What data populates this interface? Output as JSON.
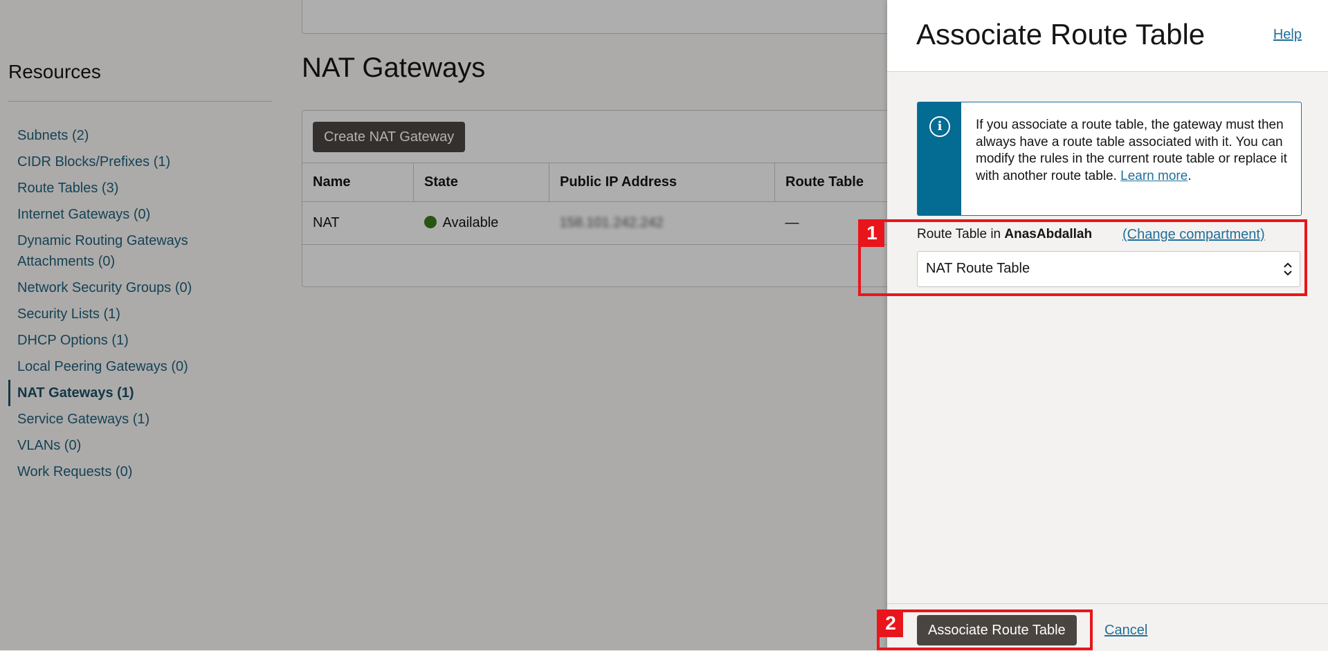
{
  "sidebar": {
    "title": "Resources",
    "items": [
      {
        "label": "Subnets (2)"
      },
      {
        "label": "CIDR Blocks/Prefixes (1)"
      },
      {
        "label": "Route Tables (3)"
      },
      {
        "label": "Internet Gateways (0)"
      },
      {
        "label": "Dynamic Routing Gateways Attachments (0)"
      },
      {
        "label": "Network Security Groups (0)"
      },
      {
        "label": "Security Lists (1)"
      },
      {
        "label": "DHCP Options (1)"
      },
      {
        "label": "Local Peering Gateways (0)"
      },
      {
        "label": "NAT Gateways (1)",
        "active": true
      },
      {
        "label": "Service Gateways (1)"
      },
      {
        "label": "VLANs (0)"
      },
      {
        "label": "Work Requests (0)"
      }
    ]
  },
  "main": {
    "title": "NAT Gateways",
    "create_button": "Create NAT Gateway",
    "columns": [
      "Name",
      "State",
      "Public IP Address",
      "Route Table"
    ],
    "rows": [
      {
        "name": "NAT",
        "state": "Available",
        "public_ip": "158.101.242.242",
        "route_table": "—"
      }
    ]
  },
  "panel": {
    "title": "Associate Route Table",
    "help": "Help",
    "info_text": "If you associate a route table, the gateway must then always have a route table associated with it. You can modify the rules in the current route table or replace it with another route table.",
    "info_link": "Learn more",
    "info_after": ".",
    "field_label_prefix": "Route Table in",
    "compartment": "AnasAbdallah",
    "change_compartment": "(Change compartment)",
    "selected_route_table": "NAT Route Table",
    "submit": "Associate Route Table",
    "cancel": "Cancel"
  },
  "annotations": {
    "step1": "1",
    "step2": "2"
  },
  "colors": {
    "accent_link": "#1f6f9a",
    "info_bar": "#046b92",
    "button_dark": "#4a4541",
    "status_available": "#3c7a1e",
    "highlight": "#e8161c"
  }
}
